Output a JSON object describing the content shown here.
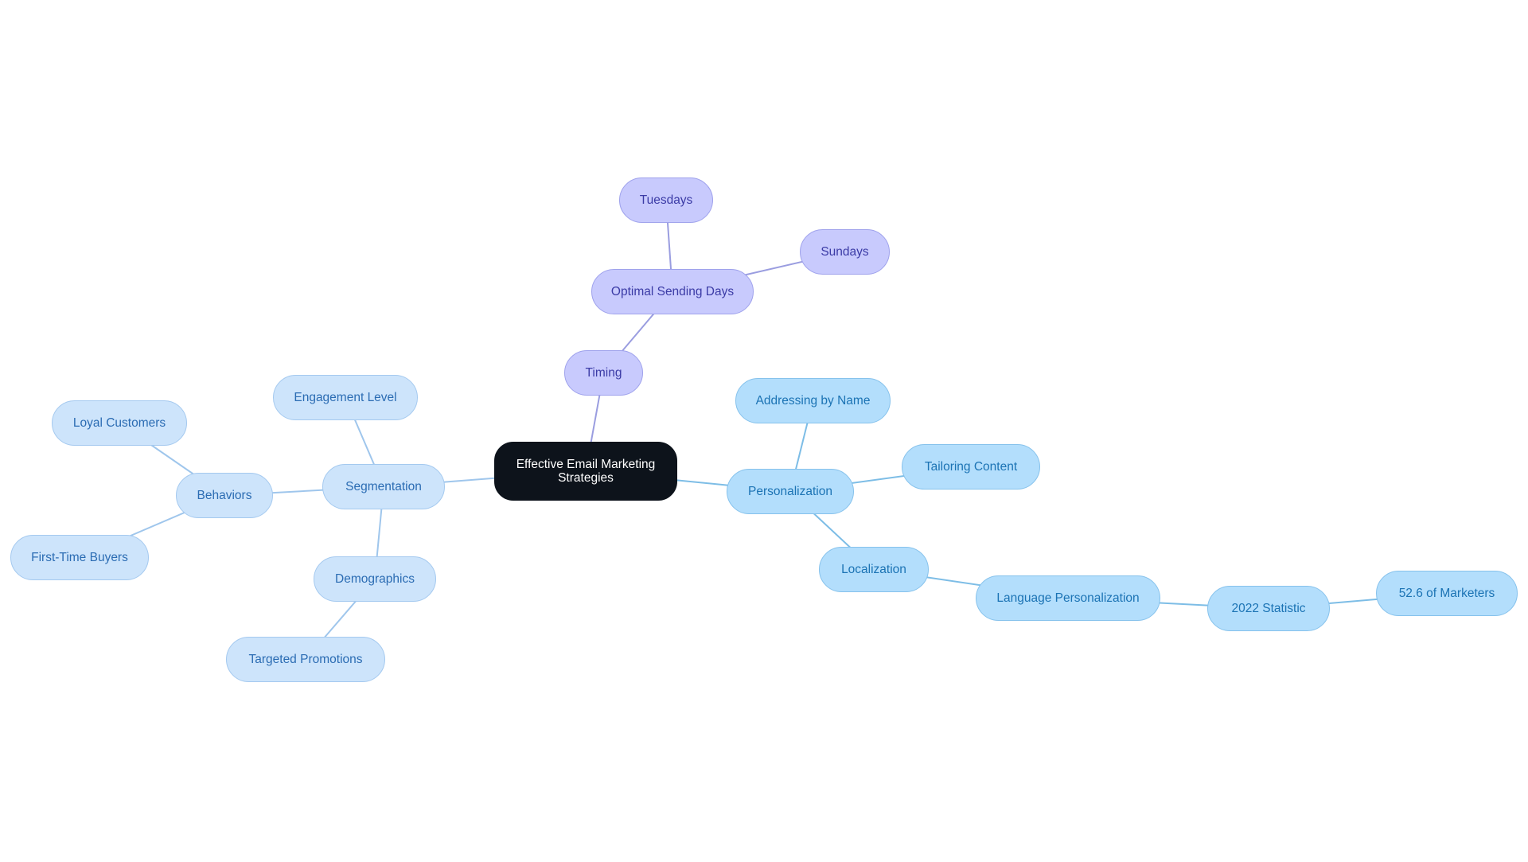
{
  "title": "Effective Email Marketing Strategies mind map",
  "colors": {
    "root_fill": "#0d131b",
    "segmentation_fill": "#cde4fb",
    "segmentation_line": "#9fc6ec",
    "timing_fill": "#c8cafd",
    "timing_line": "#9a9de0",
    "personalization_fill": "#b3defc",
    "personalization_line": "#7dbde6"
  },
  "nodes": {
    "root": "Effective Email Marketing Strategies",
    "segmentation": "Segmentation",
    "engagement_level": "Engagement Level",
    "behaviors": "Behaviors",
    "loyal_customers": "Loyal Customers",
    "first_time_buyers": "First-Time Buyers",
    "demographics": "Demographics",
    "targeted_promotions": "Targeted Promotions",
    "timing": "Timing",
    "optimal_sending_days": "Optimal Sending Days",
    "tuesdays": "Tuesdays",
    "sundays": "Sundays",
    "personalization": "Personalization",
    "addressing_by_name": "Addressing by Name",
    "tailoring_content": "Tailoring Content",
    "localization": "Localization",
    "language_personalization": "Language Personalization",
    "statistic_2022": "2022 Statistic",
    "marketers_52_6": "52.6 of Marketers"
  },
  "edges": [
    [
      "root",
      "segmentation",
      "segmentation"
    ],
    [
      "segmentation",
      "engagement_level",
      "segmentation"
    ],
    [
      "segmentation",
      "behaviors",
      "segmentation"
    ],
    [
      "behaviors",
      "loyal_customers",
      "segmentation"
    ],
    [
      "behaviors",
      "first_time_buyers",
      "segmentation"
    ],
    [
      "segmentation",
      "demographics",
      "segmentation"
    ],
    [
      "demographics",
      "targeted_promotions",
      "segmentation"
    ],
    [
      "root",
      "timing",
      "timing"
    ],
    [
      "timing",
      "optimal_sending_days",
      "timing"
    ],
    [
      "optimal_sending_days",
      "tuesdays",
      "timing"
    ],
    [
      "optimal_sending_days",
      "sundays",
      "timing"
    ],
    [
      "root",
      "personalization",
      "personalization"
    ],
    [
      "personalization",
      "addressing_by_name",
      "personalization"
    ],
    [
      "personalization",
      "tailoring_content",
      "personalization"
    ],
    [
      "personalization",
      "localization",
      "personalization"
    ],
    [
      "localization",
      "language_personalization",
      "personalization"
    ],
    [
      "language_personalization",
      "statistic_2022",
      "personalization"
    ],
    [
      "statistic_2022",
      "marketers_52_6",
      "personalization"
    ]
  ]
}
